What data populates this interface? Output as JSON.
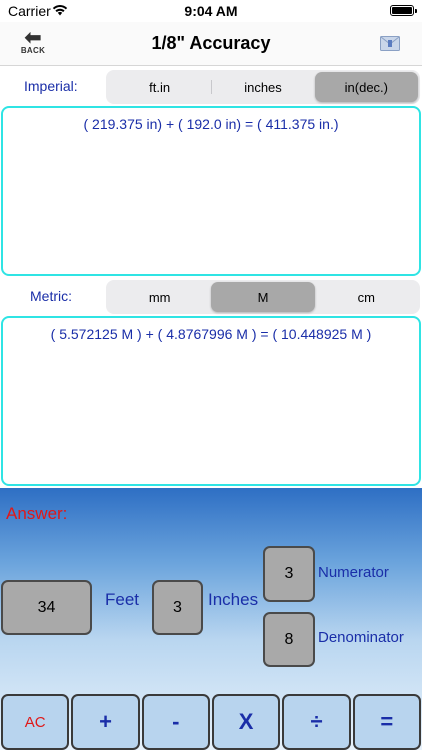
{
  "status": {
    "carrier": "Carrier",
    "time": "9:04 AM"
  },
  "nav": {
    "back_label": "BACK",
    "title": "1/8\" Accuracy"
  },
  "imperial": {
    "label": "Imperial:",
    "options": [
      "ft.in",
      "inches",
      "in(dec.)"
    ],
    "selected": "in(dec.)",
    "expression": "( 219.375 in)  +  ( 192.0 in)  =   ( 411.375 in.)"
  },
  "metric": {
    "label": "Metric:",
    "options": [
      "mm",
      "M",
      "cm"
    ],
    "selected": "M",
    "expression": "( 5.572125 M )  +  ( 4.8767996 M )  =   ( 10.448925 M )"
  },
  "answer": {
    "label": "Answer:",
    "feet_value": "34",
    "feet_label": "Feet",
    "inches_value": "3",
    "inches_label": "Inches",
    "numerator_value": "3",
    "numerator_label": "Numerator",
    "denominator_value": "8",
    "denominator_label": "Denominator"
  },
  "keypad": [
    "AC",
    "+",
    "-",
    "X",
    "÷",
    "="
  ]
}
